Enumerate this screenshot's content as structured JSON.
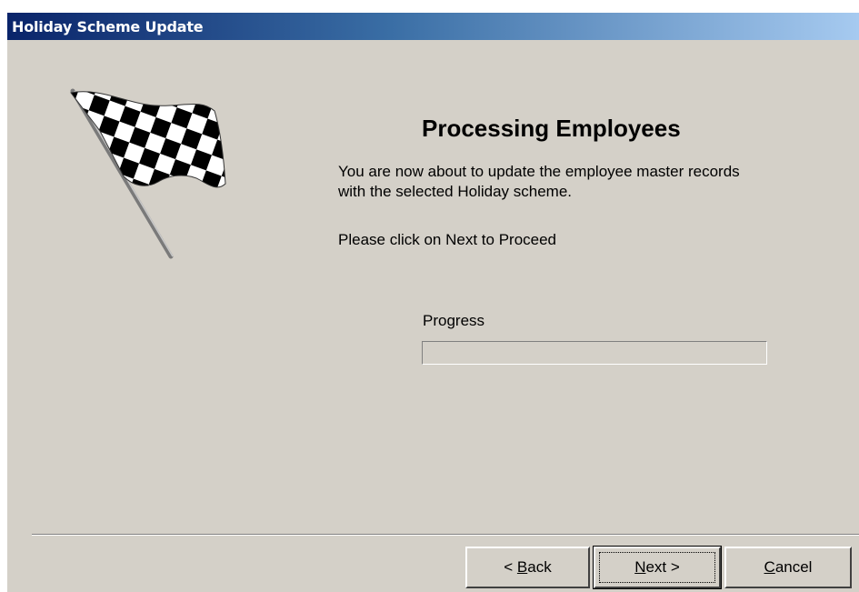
{
  "window": {
    "title": "Holiday Scheme Update",
    "colors": {
      "face": "#d4d0c8",
      "title_start": "#0a246a",
      "title_end": "#a6caf0"
    }
  },
  "main": {
    "heading": "Processing Employees",
    "description_lines": [
      "You are now about to update the employee master records",
      "with the selected Holiday scheme."
    ],
    "instruction": "Please click on Next to Proceed",
    "progress": {
      "label": "Progress",
      "value": 0
    },
    "image_icon": "checkered-flag-icon"
  },
  "buttons": {
    "back": {
      "arrow": "< ",
      "mnemonic": "B",
      "rest": "ack"
    },
    "next": {
      "mnemonic": "N",
      "rest": "ext",
      "arrow": " >"
    },
    "cancel": {
      "mnemonic": "C",
      "rest": "ancel"
    }
  }
}
